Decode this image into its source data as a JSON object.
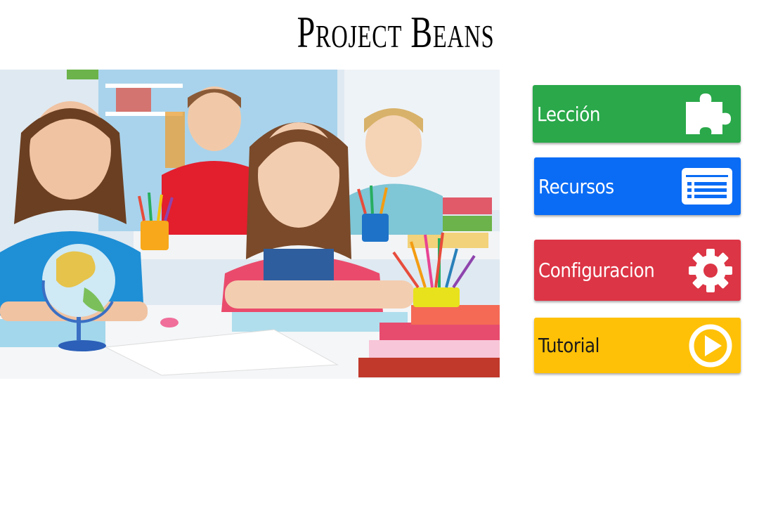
{
  "app": {
    "title": "Project Beans"
  },
  "menu": {
    "leccion": {
      "label": "Lección",
      "icon": "puzzle-icon",
      "color": "#2aa84a",
      "text_color": "#ffffff"
    },
    "recursos": {
      "label": "Recursos",
      "icon": "list-card-icon",
      "color": "#0a6cf5",
      "text_color": "#ffffff"
    },
    "configuracion": {
      "label": "Configuracion",
      "icon": "gear-icon",
      "color": "#dc3545",
      "text_color": "#ffffff"
    },
    "tutorial": {
      "label": "Tutorial",
      "icon": "play-circle-icon",
      "color": "#ffc107",
      "text_color": "#1a1a1a"
    }
  },
  "hero": {
    "alt": "children-in-classroom-photo"
  }
}
